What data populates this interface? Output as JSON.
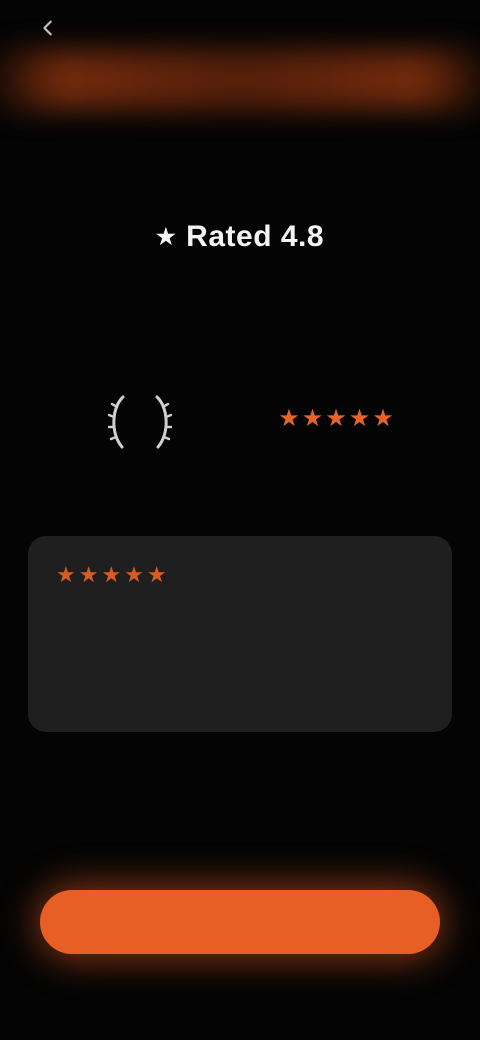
{
  "header": {
    "back_icon": "chevron-left-icon"
  },
  "hero": {
    "title": "Rated 4.8",
    "subtitle": ""
  },
  "stats": {
    "rating_value": "",
    "review_count": "",
    "review_stars": "★★★★★"
  },
  "review_card": {
    "stars": "★★★★★",
    "text": "",
    "author": ""
  },
  "footer": {
    "caption": "",
    "cta_label": "",
    "link_label": ""
  },
  "colors": {
    "accent": "#e85f26",
    "background": "#040404",
    "card": "#1f1f1f"
  }
}
